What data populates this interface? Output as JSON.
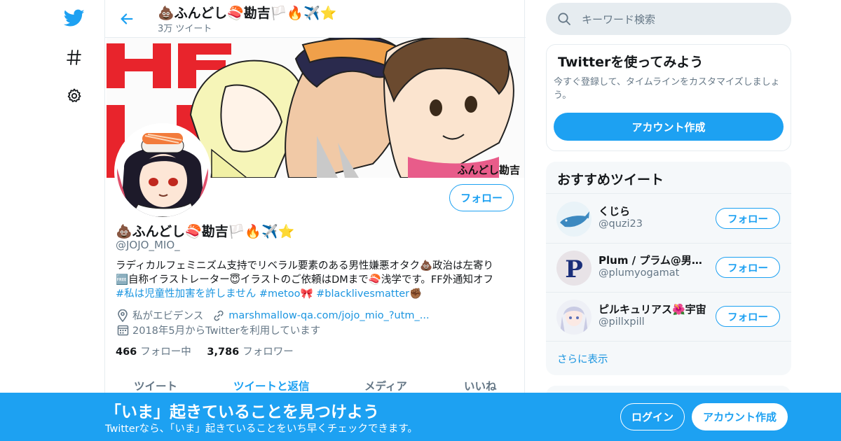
{
  "nav": {
    "icons": [
      "twitter-bird-icon",
      "hashtag-icon",
      "gear-icon"
    ]
  },
  "header": {
    "back_icon": "arrow-left-icon",
    "name": "💩ふんどし🍣勘吉🏳️🔥✈️⭐",
    "tweet_count": "3万 ツイート"
  },
  "profile": {
    "follow_label": "フォロー",
    "name": "💩ふんどし🍣勘吉🏳️🔥✈️⭐",
    "handle": "@JOJO_MIO_",
    "bio": {
      "line1": "ラディカルフェミニズム支持でリベラル要素のある男性嫌悪オタク💩政治は左寄り",
      "line2": "🆓自称イラストレーター😇イラストのご依頼はDMまで🍣浅学です。FF外通知オフ",
      "tag1": "#私は児童性加害を許しません",
      "tag2": "#metoo",
      "tag2_emoji": "🎀",
      "tag3": "#blacklivesmatter",
      "tag3_emoji": "✊🏾"
    },
    "location": "私がエビデンス",
    "link": "marshmallow-qa.com/jojo_mio_?utm_...",
    "joined": "2018年5月からTwitterを利用しています",
    "following_count": "466",
    "following_label": "フォロー中",
    "followers_count": "3,786",
    "followers_label": "フォロワー",
    "banner_signature": "ふんどし勘吉",
    "banner_letters": "HE"
  },
  "tabs": [
    {
      "label": "ツイート",
      "active": false
    },
    {
      "label": "ツイートと返信",
      "active": true
    },
    {
      "label": "メディア",
      "active": false
    },
    {
      "label": "いいね",
      "active": false
    }
  ],
  "search": {
    "placeholder": "キーワード検索",
    "icon": "search-icon"
  },
  "signup_card": {
    "title": "Twitterを使ってみよう",
    "desc": "今すぐ登録して、タイムラインをカスタマイズしましょう。",
    "button": "アカウント作成"
  },
  "recommendations": {
    "title": "おすすめツイート",
    "items": [
      {
        "name": "くじら",
        "handle": "@quzi23",
        "button": "フォロー"
      },
      {
        "name": "Plum / プラム@男女共同参画",
        "handle": "@plumyogamat",
        "button": "フォロー"
      },
      {
        "name": "ピルキュリアス🌺宇宙",
        "handle": "@pillxpill",
        "button": "フォロー"
      }
    ],
    "more": "さらに表示"
  },
  "bottom_banner": {
    "title": "「いま」起きていることを見つけよう",
    "subtitle": "Twitterなら、「いま」起きていることをいち早くチェックできます。",
    "login": "ログイン",
    "signup": "アカウント作成"
  },
  "colors": {
    "accent": "#1da1f2",
    "link": "#1b95e0",
    "muted": "#657786",
    "border": "#e6ecf0"
  }
}
